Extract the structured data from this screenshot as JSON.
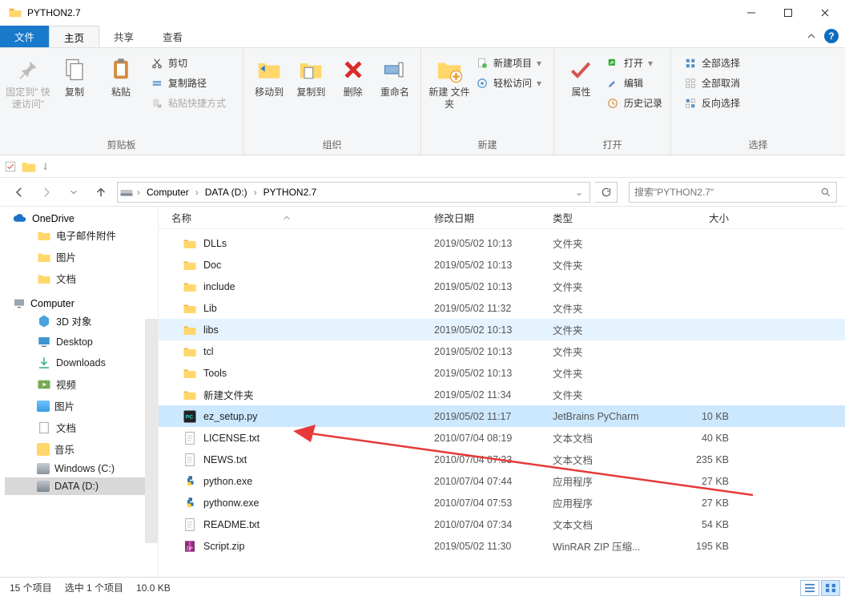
{
  "window": {
    "title": "PYTHON2.7"
  },
  "tabs": {
    "file": "文件",
    "home": "主页",
    "share": "共享",
    "view": "查看"
  },
  "ribbon": {
    "group_clipboard": "剪贴板",
    "group_organize": "组织",
    "group_new": "新建",
    "group_open": "打开",
    "group_select": "选择",
    "pin": "固定到\"\n快速访问\"",
    "copy": "复制",
    "paste": "粘贴",
    "cut": "剪切",
    "copypath": "复制路径",
    "paste_shortcut": "粘贴快捷方式",
    "moveto": "移动到",
    "copyto": "复制到",
    "delete": "删除",
    "rename": "重命名",
    "newfolder": "新建\n文件夹",
    "newitem": "新建项目",
    "easyaccess": "轻松访问",
    "properties": "属性",
    "open": "打开",
    "edit": "编辑",
    "history": "历史记录",
    "selectall": "全部选择",
    "selectnone": "全部取消",
    "invert": "反向选择"
  },
  "breadcrumbs": {
    "computer": "Computer",
    "drive": "DATA (D:)",
    "folder": "PYTHON2.7"
  },
  "search": {
    "placeholder": "搜索\"PYTHON2.7\""
  },
  "sidebar": {
    "onedrive": "OneDrive",
    "email": "电子邮件附件",
    "pictures": "图片",
    "docs": "文档",
    "computer": "Computer",
    "obj3d": "3D 对象",
    "desktop": "Desktop",
    "downloads": "Downloads",
    "videos": "视频",
    "pictures2": "图片",
    "docs2": "文档",
    "music": "音乐",
    "cdrive": "Windows (C:)",
    "ddrive": "DATA (D:)"
  },
  "columns": {
    "name": "名称",
    "date": "修改日期",
    "type": "类型",
    "size": "大小"
  },
  "files": [
    {
      "name": "DLLs",
      "date": "2019/05/02 10:13",
      "type": "文件夹",
      "size": "",
      "icon": "folder"
    },
    {
      "name": "Doc",
      "date": "2019/05/02 10:13",
      "type": "文件夹",
      "size": "",
      "icon": "folder"
    },
    {
      "name": "include",
      "date": "2019/05/02 10:13",
      "type": "文件夹",
      "size": "",
      "icon": "folder"
    },
    {
      "name": "Lib",
      "date": "2019/05/02 11:32",
      "type": "文件夹",
      "size": "",
      "icon": "folder"
    },
    {
      "name": "libs",
      "date": "2019/05/02 10:13",
      "type": "文件夹",
      "size": "",
      "icon": "folder",
      "state": "hover"
    },
    {
      "name": "tcl",
      "date": "2019/05/02 10:13",
      "type": "文件夹",
      "size": "",
      "icon": "folder"
    },
    {
      "name": "Tools",
      "date": "2019/05/02 10:13",
      "type": "文件夹",
      "size": "",
      "icon": "folder"
    },
    {
      "name": "新建文件夹",
      "date": "2019/05/02 11:34",
      "type": "文件夹",
      "size": "",
      "icon": "folder"
    },
    {
      "name": "ez_setup.py",
      "date": "2019/05/02 11:17",
      "type": "JetBrains PyCharm",
      "size": "10 KB",
      "icon": "pycharm",
      "state": "selected"
    },
    {
      "name": "LICENSE.txt",
      "date": "2010/07/04 08:19",
      "type": "文本文档",
      "size": "40 KB",
      "icon": "txt"
    },
    {
      "name": "NEWS.txt",
      "date": "2010/07/04 07:33",
      "type": "文本文档",
      "size": "235 KB",
      "icon": "txt"
    },
    {
      "name": "python.exe",
      "date": "2010/07/04 07:44",
      "type": "应用程序",
      "size": "27 KB",
      "icon": "python"
    },
    {
      "name": "pythonw.exe",
      "date": "2010/07/04 07:53",
      "type": "应用程序",
      "size": "27 KB",
      "icon": "python"
    },
    {
      "name": "README.txt",
      "date": "2010/07/04 07:34",
      "type": "文本文档",
      "size": "54 KB",
      "icon": "txt"
    },
    {
      "name": "Script.zip",
      "date": "2019/05/02 11:30",
      "type": "WinRAR ZIP 压缩...",
      "size": "195 KB",
      "icon": "zip"
    }
  ],
  "status": {
    "count": "15 个项目",
    "selected": "选中 1 个项目",
    "size": "10.0 KB"
  }
}
